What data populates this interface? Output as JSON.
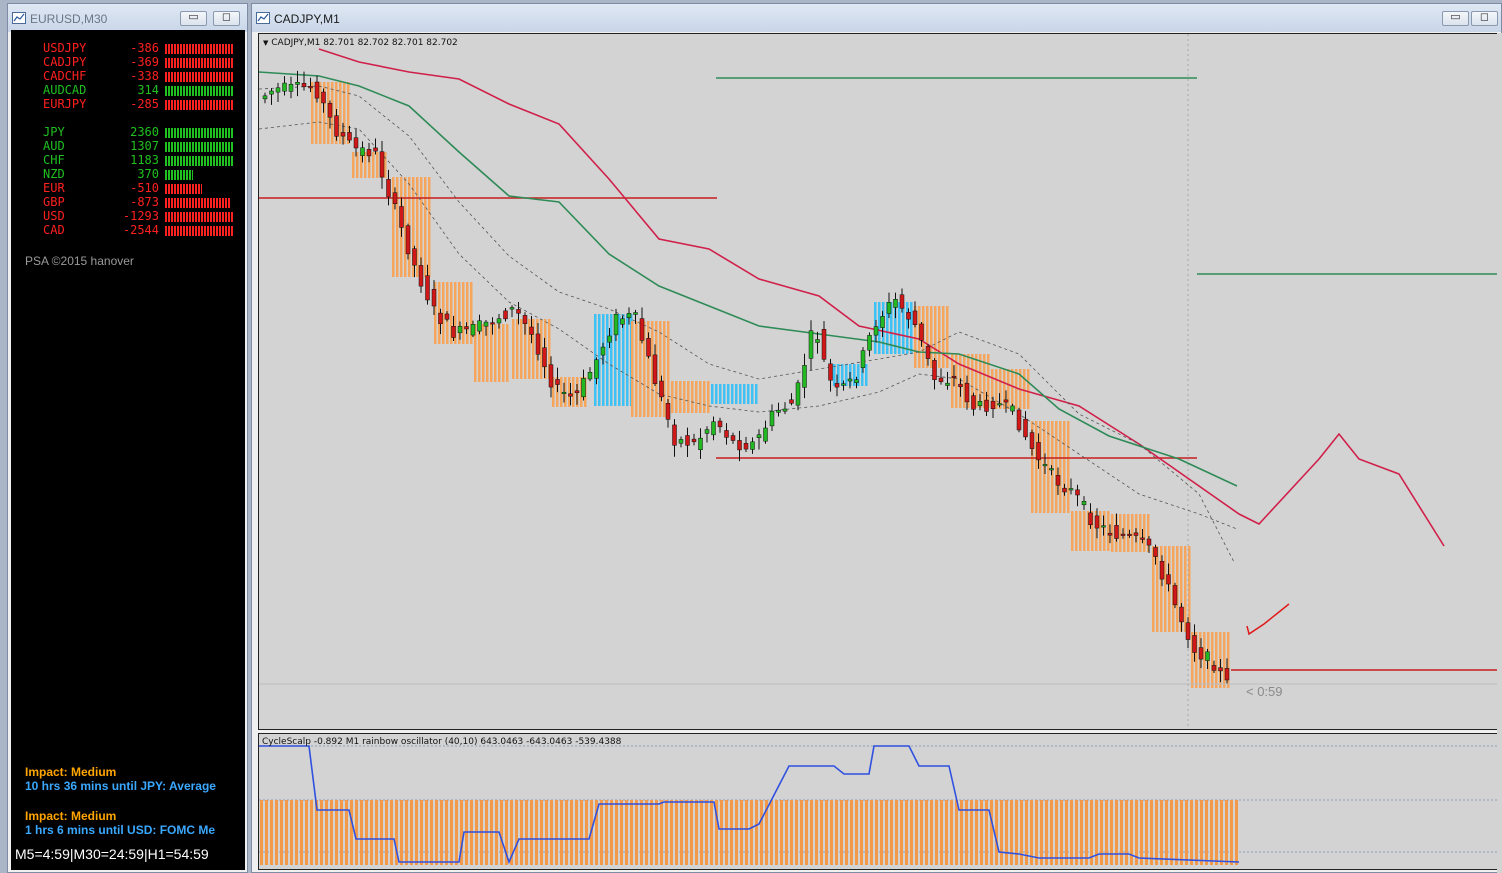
{
  "windows": {
    "left": {
      "title": "EURUSD,M30",
      "minimize": "▭",
      "maximize": "◻"
    },
    "right": {
      "title": "CADJPY,M1",
      "minimize": "▭",
      "maximize": "◻"
    }
  },
  "strength_panel": {
    "pairs": [
      {
        "name": "USDJPY",
        "value": "-386",
        "color": "#ff2020",
        "bar": 0.86
      },
      {
        "name": "CADJPY",
        "value": "-369",
        "color": "#ff2020",
        "bar": 0.86
      },
      {
        "name": "CADCHF",
        "value": "-338",
        "color": "#ff2020",
        "bar": 0.86
      },
      {
        "name": "AUDCAD",
        "value": "314",
        "color": "#20c020",
        "bar": 0.86
      },
      {
        "name": "EURJPY",
        "value": "-285",
        "color": "#ff2020",
        "bar": 0.86
      }
    ],
    "currencies": [
      {
        "name": "JPY",
        "value": "2360",
        "color": "#20c020",
        "bar": 0.86
      },
      {
        "name": "AUD",
        "value": "1307",
        "color": "#20c020",
        "bar": 0.86
      },
      {
        "name": "CHF",
        "value": "1183",
        "color": "#20c020",
        "bar": 0.86
      },
      {
        "name": "NZD",
        "value": "370",
        "color": "#20c020",
        "bar": 0.35
      },
      {
        "name": "EUR",
        "value": "-510",
        "color": "#ff2020",
        "bar": 0.46
      },
      {
        "name": "GBP",
        "value": "-873",
        "color": "#ff2020",
        "bar": 0.82
      },
      {
        "name": "USD",
        "value": "-1293",
        "color": "#ff2020",
        "bar": 0.86
      },
      {
        "name": "CAD",
        "value": "-2544",
        "color": "#ff2020",
        "bar": 0.86
      }
    ],
    "credit": "PSA ©2015 hanover"
  },
  "news": [
    {
      "impact": "Impact: Medium",
      "text": "10 hrs 36 mins until JPY: Average"
    },
    {
      "impact": "Impact: Medium",
      "text": "1 hrs 6 mins until USD: FOMC Me"
    }
  ],
  "news_colors": {
    "impact": "#ffa500",
    "text": "#3aa8ff"
  },
  "timers": "M5=4:59|M30=24:59|H1=54:59",
  "chart": {
    "info": "CADJPY,M1  82.701 82.702 82.701 82.702",
    "countdown": "< 0:59"
  },
  "oscillator": {
    "label": "CycleScalp -0.892  M1 rainbow oscillator (40,10) 643.0463 -643.0463 -539.4388"
  }
}
